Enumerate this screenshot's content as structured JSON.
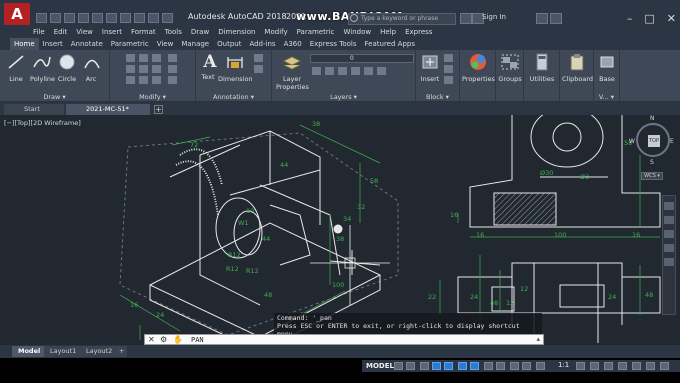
{
  "titlebar": {
    "app_logo": "A",
    "title": "Autodesk AutoCAD 2018",
    "file_name": "2021",
    "watermark": "www.BANDICAM.com",
    "search_placeholder": "Type a keyword or phrase",
    "signin_label": "Sign In",
    "win_controls": [
      "–",
      "□",
      "✕"
    ]
  },
  "menu": [
    "File",
    "Edit",
    "View",
    "Insert",
    "Format",
    "Tools",
    "Draw",
    "Dimension",
    "Modify",
    "Parametric",
    "Window",
    "Help",
    "Express"
  ],
  "ribbon_tabs": [
    {
      "label": "Home",
      "active": true
    },
    {
      "label": "Insert"
    },
    {
      "label": "Annotate"
    },
    {
      "label": "Parametric"
    },
    {
      "label": "View"
    },
    {
      "label": "Manage"
    },
    {
      "label": "Output"
    },
    {
      "label": "Add-ins"
    },
    {
      "label": "A360"
    },
    {
      "label": "Express Tools"
    },
    {
      "label": "Featured Apps"
    }
  ],
  "ribbon": {
    "draw": {
      "label": "Draw ▾",
      "tools": [
        "Line",
        "Polyline",
        "Circle",
        "Arc"
      ]
    },
    "modify": {
      "label": "Modify ▾"
    },
    "annotation": {
      "label": "Annotation ▾",
      "tools": [
        "Text",
        "Dimension"
      ]
    },
    "layers": {
      "label": "Layers ▾",
      "tool": "Layer Properties",
      "layer_value": "0"
    },
    "block": {
      "label": "Block ▾",
      "tool": "Insert"
    },
    "properties": {
      "tool": "Properties"
    },
    "groups": {
      "tool": "Groups"
    },
    "utilities": {
      "tool": "Utilities"
    },
    "clipboard": {
      "tool": "Clipboard"
    },
    "base": {
      "tool": "Base"
    },
    "view_short": {
      "label": "V... ▾"
    }
  },
  "file_tabs": [
    {
      "label": "Start",
      "active": false
    },
    {
      "label": "2021-MC-51*",
      "active": true
    }
  ],
  "new_tab_glyph": "+",
  "drawing": {
    "view_label": "[−][Top][2D Wireframe]",
    "viewcube": {
      "face": "TOP",
      "n": "N",
      "s": "S",
      "e": "E",
      "w": "W"
    },
    "wcs_label": "WCS ▾",
    "dims_iso": [
      "72",
      "38",
      "44",
      "58",
      "32",
      "34",
      "38",
      "100",
      "32",
      "48",
      "24",
      "16",
      "10",
      "44",
      "R12",
      "R12",
      "R12",
      "W1"
    ],
    "dims_right": [
      "58",
      "Ø30",
      "Ø3",
      "16",
      "16",
      "100",
      "16",
      "22",
      "24",
      "48",
      "12",
      "12",
      "24",
      "48"
    ]
  },
  "command": {
    "history_line1": "Command: '_pan",
    "history_line2": "Press ESC or ENTER to exit, or right-click to display shortcut menu.",
    "current": "PAN"
  },
  "layout_tabs": [
    {
      "label": "Model",
      "active": true
    },
    {
      "label": "Layout1"
    },
    {
      "label": "Layout2"
    }
  ],
  "layout_add_glyph": "+",
  "statusbar": {
    "model": "MODEL",
    "scale": "1:1"
  },
  "colors": {
    "accent_red": "#b52025",
    "model_space": "#212830",
    "ui_dark": "#2c3543",
    "linework": "#e9e9e9",
    "dimension_green": "#3fb04f"
  }
}
